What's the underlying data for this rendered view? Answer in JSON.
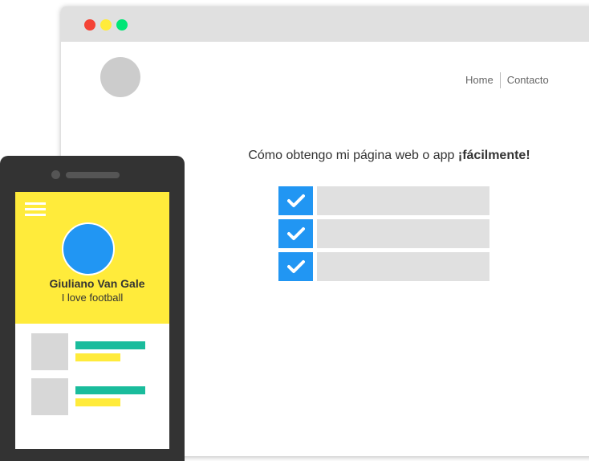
{
  "colors": {
    "accent_blue": "#2196f3",
    "accent_yellow": "#ffeb3b",
    "accent_teal": "#1abc9c",
    "traffic_red": "#f44336",
    "traffic_yellow": "#ffeb3b",
    "traffic_green": "#00e676"
  },
  "browser": {
    "nav": [
      "Home",
      "Contacto"
    ],
    "headline_text": "Cómo obtengo mi página web o app ",
    "headline_strong": "¡fácilmente!",
    "checklist_items": 3
  },
  "phone": {
    "profile_name": "Giuliano Van Gale",
    "profile_bio": "I love football",
    "feed_items": 2
  }
}
